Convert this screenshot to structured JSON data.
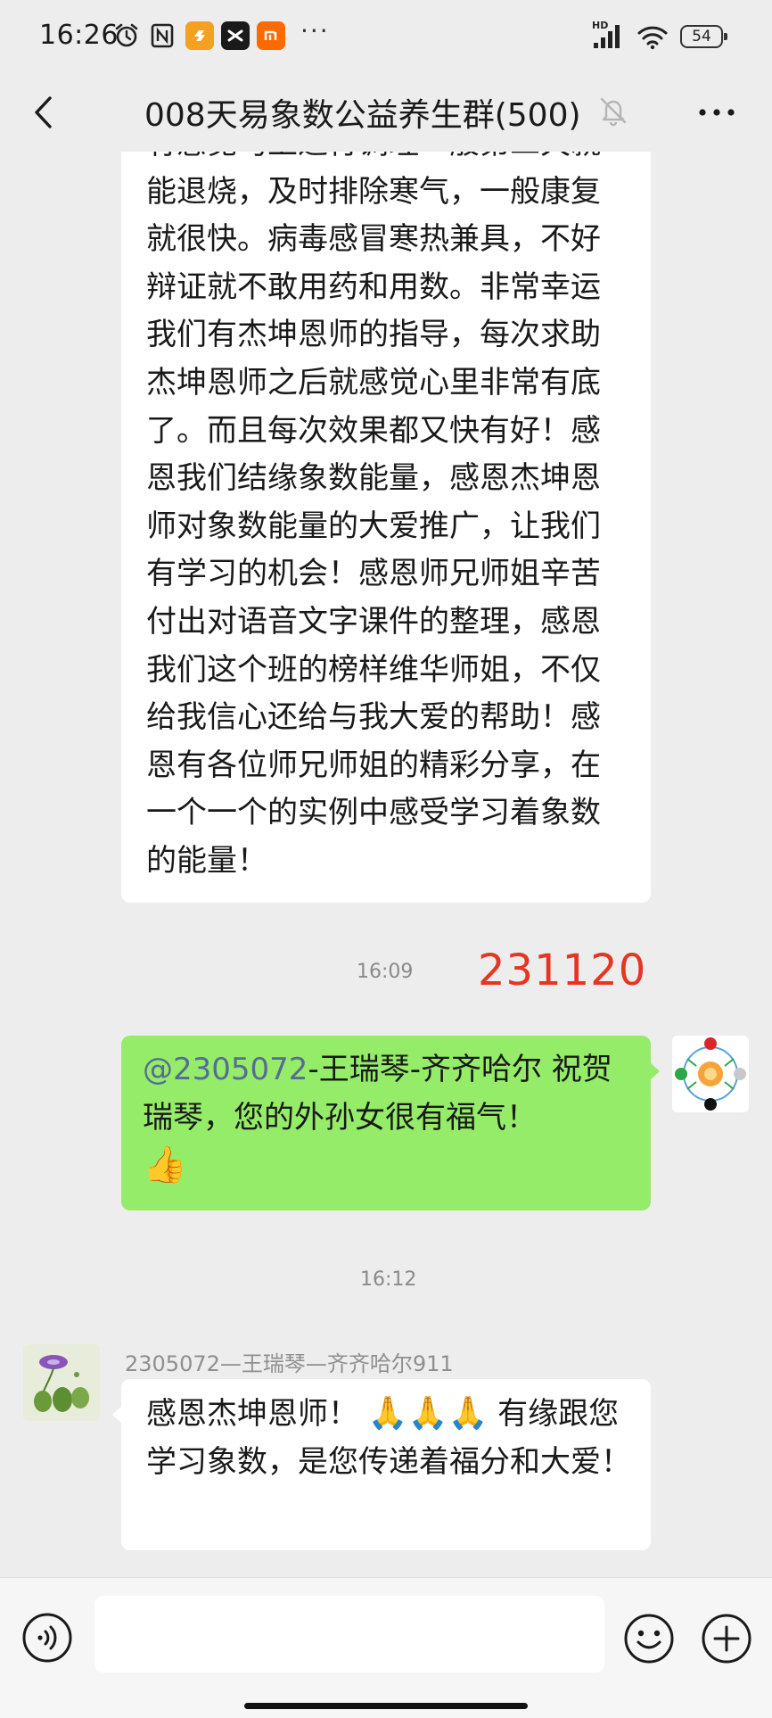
{
  "status_bar": {
    "time": "16:26",
    "more": "···",
    "network": "HD",
    "battery": "54"
  },
  "header": {
    "title": "008天易象数公益养生群(500)"
  },
  "messages": [
    {
      "type": "text-received",
      "text": "有感觉马上进行调理一般第二天就能退烧，及时排除寒气，一般康复就很快。病毒感冒寒热兼具，不好辩证就不敢用药和用数。非常幸运我们有杰坤恩师的指导，每次求助杰坤恩师之后就感觉心里非常有底了。而且每次效果都又快有好！感恩我们结缘象数能量，感恩杰坤恩师对象数能量的大爱推广，让我们有学习的机会！感恩师兄师姐辛苦付出对语音文字课件的整理，感恩我们这个班的榜样维华师姐，不仅给我信心还给与我大爱的帮助！感恩有各位师兄师姐的精彩分享，在一个一个的实例中感受学习着象数的能量！"
    },
    {
      "type": "timestamp",
      "text": "16:09",
      "overlay": "231120"
    },
    {
      "type": "text-sent",
      "mention": "@2305072",
      "text": "-王瑞琴-齐齐哈尔  祝贺瑞琴，您的外孙女很有福气！",
      "emoji": "👍"
    },
    {
      "type": "timestamp",
      "text": "16:12"
    },
    {
      "type": "text-received",
      "sender": "2305072—王瑞琴—齐齐哈尔911",
      "text_a": "感恩杰坤恩师！",
      "emoji": "🙏🙏🙏",
      "text_b": " 有缘跟您学习象数，是您传递着福分和大爱！"
    }
  ],
  "colors": {
    "background": "#ededed",
    "sent_bubble": "#95ec69",
    "received_bubble": "#ffffff",
    "mention": "#576b95",
    "overlay_red": "#e53523"
  },
  "input_bar": {
    "placeholder": ""
  }
}
